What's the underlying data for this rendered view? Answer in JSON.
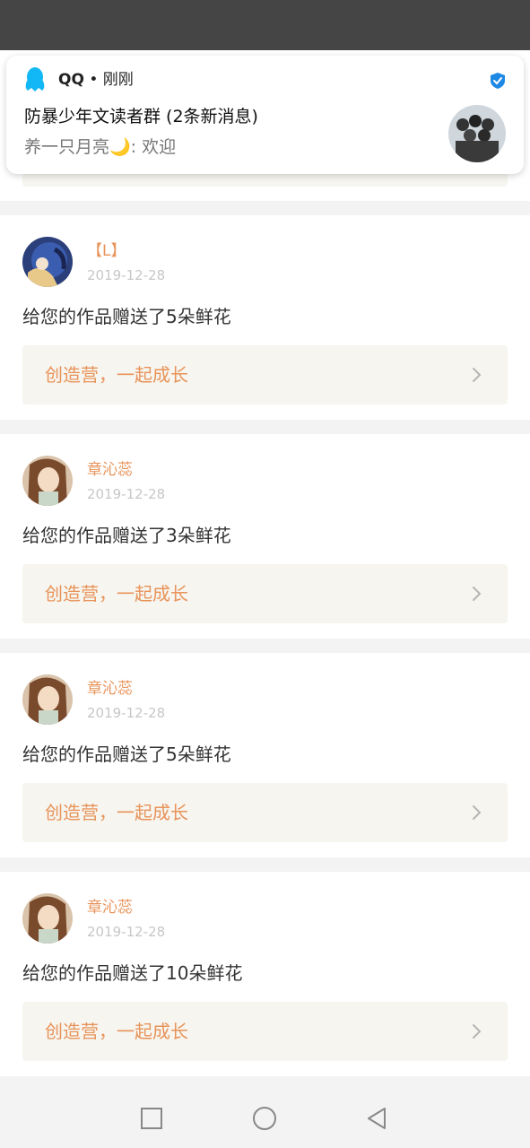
{
  "notification": {
    "app_name": "QQ",
    "time": "刚刚",
    "title": "防暴少年文读者群 (2条新消息)",
    "body": "养一只月亮🌙: 欢迎"
  },
  "items": [
    {
      "name": "【L】",
      "date": "2019-12-28",
      "message": "给您的作品赠送了5朵鲜花",
      "camp": "创造营，一起成长"
    },
    {
      "name": "章沁蕊",
      "date": "2019-12-28",
      "message": "给您的作品赠送了3朵鲜花",
      "camp": "创造营，一起成长"
    },
    {
      "name": "章沁蕊",
      "date": "2019-12-28",
      "message": "给您的作品赠送了5朵鲜花",
      "camp": "创造营，一起成长"
    },
    {
      "name": "章沁蕊",
      "date": "2019-12-28",
      "message": "给您的作品赠送了10朵鲜花",
      "camp": "创造营，一起成长"
    }
  ],
  "colors": {
    "accent": "#e8935a",
    "banner_bg": "#f6f5ef",
    "verify": "#1e88e5",
    "qq_blue": "#12b7f5"
  },
  "icons": [
    "qq-icon",
    "verified-icon",
    "chevron-right-icon",
    "nav-recents-icon",
    "nav-home-icon",
    "nav-back-icon"
  ]
}
